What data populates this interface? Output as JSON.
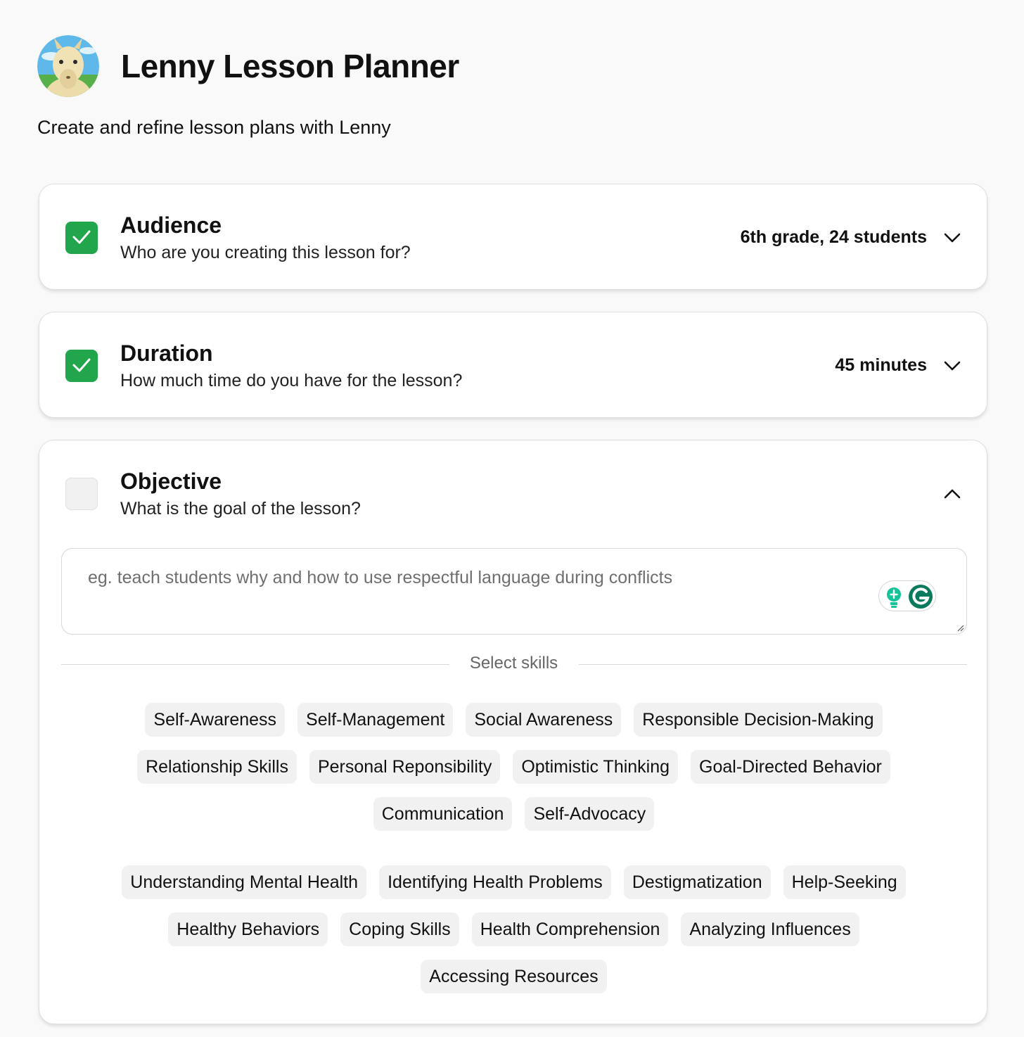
{
  "header": {
    "title": "Lenny Lesson Planner",
    "subtitle": "Create and refine lesson plans with Lenny",
    "avatar_icon": "llama-avatar-icon"
  },
  "colors": {
    "check_green": "#22a64b",
    "page_bg": "#f9f9f9",
    "chip_bg": "#f1f1f1",
    "grammarly_teal": "#15c39a",
    "grammarly_dark": "#0b7a5c"
  },
  "sections": {
    "audience": {
      "title": "Audience",
      "description": "Who are you creating this lesson for?",
      "value": "6th grade, 24 students",
      "checked": true,
      "expanded": false
    },
    "duration": {
      "title": "Duration",
      "description": "How much time do you have for the lesson?",
      "value": "45 minutes",
      "checked": true,
      "expanded": false
    },
    "objective": {
      "title": "Objective",
      "description": "What is the goal of the lesson?",
      "checked": false,
      "expanded": true,
      "input_value": "",
      "input_placeholder": "eg. teach students why and how to use respectful language during conflicts",
      "skills_label": "Select skills",
      "skill_groups": [
        [
          [
            "Self-Awareness",
            "Self-Management",
            "Social Awareness",
            "Responsible Decision-Making"
          ],
          [
            "Relationship Skills",
            "Personal Reponsibility",
            "Optimistic Thinking",
            "Goal-Directed Behavior"
          ],
          [
            "Communication",
            "Self-Advocacy"
          ]
        ],
        [
          [
            "Understanding Mental Health",
            "Identifying Health Problems",
            "Destigmatization",
            "Help-Seeking"
          ],
          [
            "Healthy Behaviors",
            "Coping Skills",
            "Health Comprehension",
            "Analyzing Influences"
          ],
          [
            "Accessing Resources"
          ]
        ]
      ]
    }
  }
}
